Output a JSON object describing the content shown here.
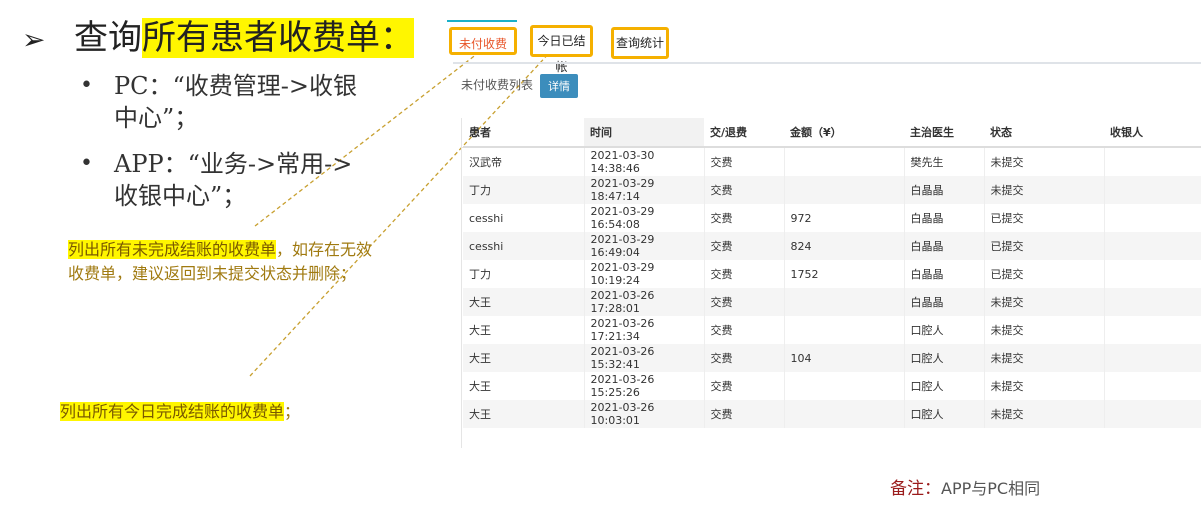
{
  "slide": {
    "heading_prefix": "查询",
    "heading_highlight": "所有患者收费单",
    "heading_suffix": "：",
    "bullets": [
      {
        "line1": "PC：“收费管理->收银",
        "line2": "中心”；"
      },
      {
        "line1": "APP：“业务->常用->",
        "line2": "收银中心”；"
      }
    ],
    "note1": {
      "highlight": "列出所有未完成结账的收费单",
      "rest1": "，如存在无效",
      "line2": "收费单，建议返回到未提交状态并删除；"
    },
    "note2": {
      "highlight": "列出所有今日完成结账的收费单",
      "rest": "；"
    },
    "footnote_label": "备注：",
    "footnote_text": "APP与PC相同"
  },
  "tabs": [
    {
      "label": "未付收费",
      "active": true
    },
    {
      "label": "今日已结帐",
      "active": false
    },
    {
      "label": "查询统计",
      "active": false
    }
  ],
  "panel": {
    "list_label": "未付收费列表",
    "detail_button": "详情"
  },
  "table": {
    "headers": [
      "患者",
      "时间",
      "交/退费",
      "金额（¥）",
      "主治医生",
      "状态",
      "收银人"
    ],
    "rows": [
      [
        "汉武帝",
        "2021-03-30 14:38:46",
        "交费",
        "",
        "樊先生",
        "未提交",
        ""
      ],
      [
        "丁力",
        "2021-03-29 18:47:14",
        "交费",
        "",
        "白晶晶",
        "未提交",
        ""
      ],
      [
        "cesshi",
        "2021-03-29 16:54:08",
        "交费",
        "972",
        "白晶晶",
        "已提交",
        ""
      ],
      [
        "cesshi",
        "2021-03-29 16:49:04",
        "交费",
        "824",
        "白晶晶",
        "已提交",
        ""
      ],
      [
        "丁力",
        "2021-03-29 10:19:24",
        "交费",
        "1752",
        "白晶晶",
        "已提交",
        ""
      ],
      [
        "大王",
        "2021-03-26 17:28:01",
        "交费",
        "",
        "白晶晶",
        "未提交",
        ""
      ],
      [
        "大王",
        "2021-03-26 17:21:34",
        "交费",
        "",
        "口腔人",
        "未提交",
        ""
      ],
      [
        "大王",
        "2021-03-26 15:32:41",
        "交费",
        "104",
        "口腔人",
        "未提交",
        ""
      ],
      [
        "大王",
        "2021-03-26 15:25:26",
        "交费",
        "",
        "口腔人",
        "未提交",
        ""
      ],
      [
        "大王",
        "2021-03-26 10:03:01",
        "交费",
        "",
        "口腔人",
        "未提交",
        ""
      ]
    ]
  },
  "colors": {
    "tab_border": "#f5b000",
    "highlight": "#fff600",
    "detail_button": "#3c8dbc",
    "leader_line": "#c8a030"
  },
  "icons": {
    "heading_bullet": "arrow-right-icon"
  }
}
